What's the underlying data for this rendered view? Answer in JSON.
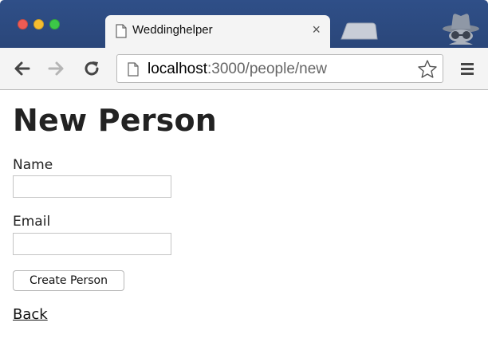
{
  "browser": {
    "tab": {
      "title": "Weddinghelper",
      "close_symbol": "×"
    },
    "address_bar": {
      "host": "localhost",
      "path": ":3000/people/new"
    },
    "traffic_lights": {
      "close": "#ee5b54",
      "minimize": "#f6bd2f",
      "maximize": "#3cc748"
    },
    "icons": [
      "back-arrow-icon",
      "forward-arrow-icon",
      "reload-icon",
      "page-icon",
      "bookmark-star-icon",
      "menu-icon",
      "incognito-icon"
    ]
  },
  "page": {
    "heading": "New Person",
    "form": {
      "name_label": "Name",
      "name_value": "",
      "email_label": "Email",
      "email_value": "",
      "submit_label": "Create Person"
    },
    "back_link": "Back"
  }
}
